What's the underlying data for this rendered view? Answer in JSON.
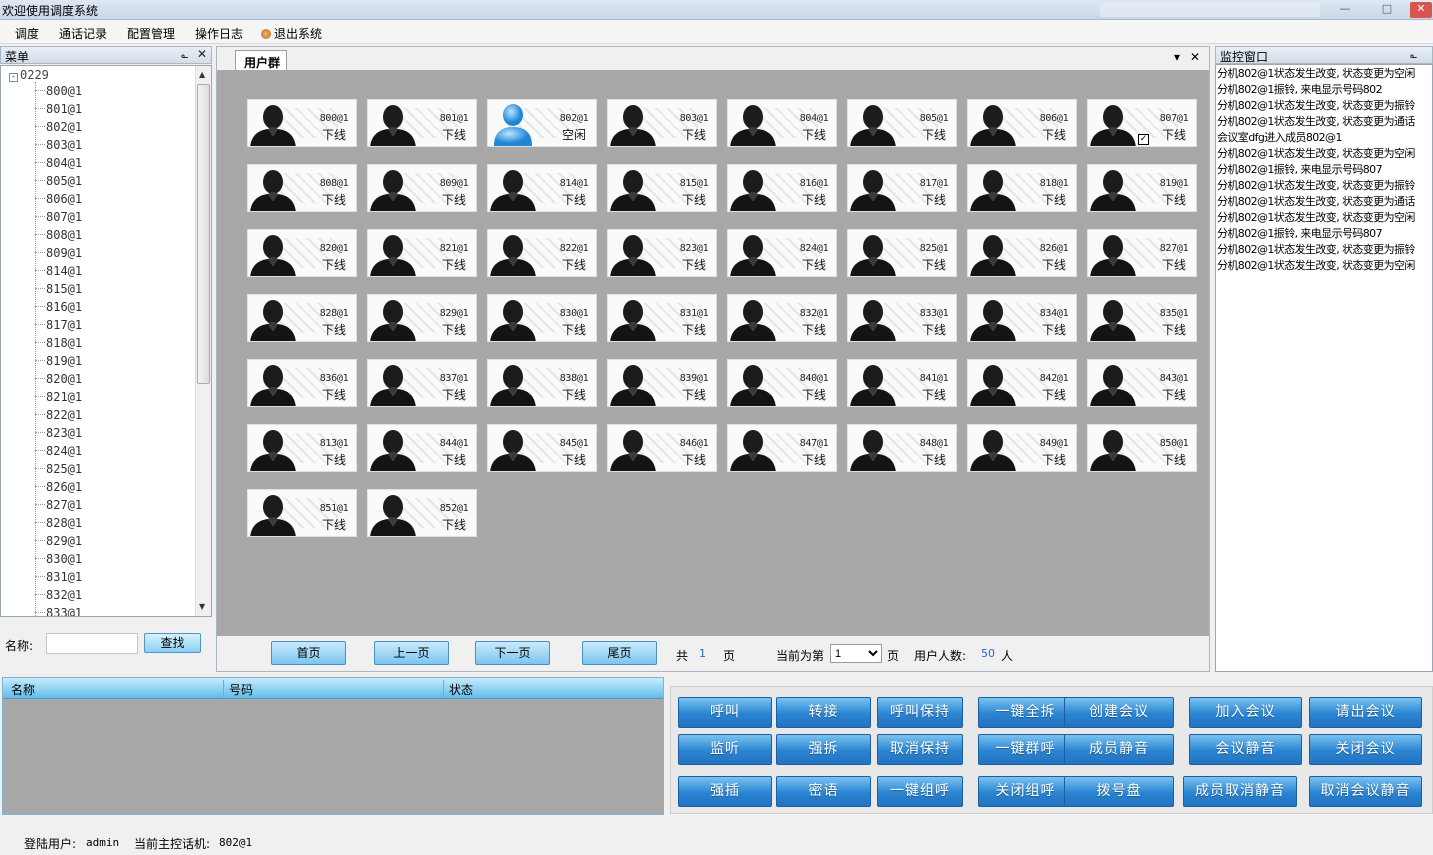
{
  "window": {
    "title": "欢迎使用调度系统"
  },
  "menubar": {
    "items": [
      "调度",
      "通话记录",
      "配置管理",
      "操作日志",
      "退出系统"
    ]
  },
  "menu_panel": {
    "title": "菜单"
  },
  "tree": {
    "root": "0229",
    "nodes": [
      "800@1",
      "801@1",
      "802@1",
      "803@1",
      "804@1",
      "805@1",
      "806@1",
      "807@1",
      "808@1",
      "809@1",
      "814@1",
      "815@1",
      "816@1",
      "817@1",
      "818@1",
      "819@1",
      "820@1",
      "821@1",
      "822@1",
      "823@1",
      "824@1",
      "825@1",
      "826@1",
      "827@1",
      "828@1",
      "829@1",
      "830@1",
      "831@1",
      "832@1",
      "833@1"
    ]
  },
  "search": {
    "label": "名称:",
    "value": "",
    "button": "查找"
  },
  "tabs": {
    "active": "用户群"
  },
  "users": [
    {
      "ext": "800@1",
      "status": "下线"
    },
    {
      "ext": "801@1",
      "status": "下线"
    },
    {
      "ext": "802@1",
      "status": "空闲",
      "online": true
    },
    {
      "ext": "803@1",
      "status": "下线"
    },
    {
      "ext": "804@1",
      "status": "下线"
    },
    {
      "ext": "805@1",
      "status": "下线"
    },
    {
      "ext": "806@1",
      "status": "下线"
    },
    {
      "ext": "807@1",
      "status": "下线",
      "checked": true
    },
    {
      "ext": "808@1",
      "status": "下线"
    },
    {
      "ext": "809@1",
      "status": "下线"
    },
    {
      "ext": "814@1",
      "status": "下线"
    },
    {
      "ext": "815@1",
      "status": "下线"
    },
    {
      "ext": "816@1",
      "status": "下线"
    },
    {
      "ext": "817@1",
      "status": "下线"
    },
    {
      "ext": "818@1",
      "status": "下线"
    },
    {
      "ext": "819@1",
      "status": "下线"
    },
    {
      "ext": "820@1",
      "status": "下线"
    },
    {
      "ext": "821@1",
      "status": "下线"
    },
    {
      "ext": "822@1",
      "status": "下线"
    },
    {
      "ext": "823@1",
      "status": "下线"
    },
    {
      "ext": "824@1",
      "status": "下线"
    },
    {
      "ext": "825@1",
      "status": "下线"
    },
    {
      "ext": "826@1",
      "status": "下线"
    },
    {
      "ext": "827@1",
      "status": "下线"
    },
    {
      "ext": "828@1",
      "status": "下线"
    },
    {
      "ext": "829@1",
      "status": "下线"
    },
    {
      "ext": "830@1",
      "status": "下线"
    },
    {
      "ext": "831@1",
      "status": "下线"
    },
    {
      "ext": "832@1",
      "status": "下线"
    },
    {
      "ext": "833@1",
      "status": "下线"
    },
    {
      "ext": "834@1",
      "status": "下线"
    },
    {
      "ext": "835@1",
      "status": "下线"
    },
    {
      "ext": "836@1",
      "status": "下线"
    },
    {
      "ext": "837@1",
      "status": "下线"
    },
    {
      "ext": "838@1",
      "status": "下线"
    },
    {
      "ext": "839@1",
      "status": "下线"
    },
    {
      "ext": "840@1",
      "status": "下线"
    },
    {
      "ext": "841@1",
      "status": "下线"
    },
    {
      "ext": "842@1",
      "status": "下线"
    },
    {
      "ext": "843@1",
      "status": "下线"
    },
    {
      "ext": "813@1",
      "status": "下线"
    },
    {
      "ext": "844@1",
      "status": "下线"
    },
    {
      "ext": "845@1",
      "status": "下线"
    },
    {
      "ext": "846@1",
      "status": "下线"
    },
    {
      "ext": "847@1",
      "status": "下线"
    },
    {
      "ext": "848@1",
      "status": "下线"
    },
    {
      "ext": "849@1",
      "status": "下线"
    },
    {
      "ext": "850@1",
      "status": "下线"
    },
    {
      "ext": "851@1",
      "status": "下线"
    },
    {
      "ext": "852@1",
      "status": "下线"
    }
  ],
  "pager": {
    "first": "首页",
    "prev": "上一页",
    "next": "下一页",
    "last": "尾页",
    "total_prefix": "共",
    "total_pages": "1",
    "total_suffix": "页",
    "current_prefix": "当前为第",
    "current_page": "1",
    "current_suffix": "页",
    "count_label": "用户人数:",
    "count_value": "50",
    "count_unit": "人"
  },
  "monitor": {
    "title": "监控窗口",
    "lines": [
      "分机802@1状态发生改变, 状态变更为空闲",
      "分机802@1振铃, 来电显示号码802",
      "分机802@1状态发生改变, 状态变更为振铃",
      "分机802@1状态发生改变, 状态变更为通话",
      "会议室dfg进入成员802@1",
      "分机802@1状态发生改变, 状态变更为空闲",
      "分机802@1振铃, 来电显示号码807",
      "分机802@1状态发生改变, 状态变更为振铃",
      "分机802@1状态发生改变, 状态变更为通话",
      "分机802@1状态发生改变, 状态变更为空闲",
      "分机802@1振铃, 来电显示号码807",
      "分机802@1状态发生改变, 状态变更为振铃",
      "分机802@1状态发生改变, 状态变更为空闲"
    ]
  },
  "grid": {
    "columns": [
      "名称",
      "号码",
      "状态"
    ]
  },
  "actions": {
    "row1": [
      "呼叫",
      "转接",
      "呼叫保持",
      "一键全拆",
      "创建会议",
      "加入会议",
      "请出会议"
    ],
    "row2": [
      "监听",
      "强拆",
      "取消保持",
      "一键群呼",
      "成员静音",
      "会议静音",
      "关闭会议"
    ],
    "row3": [
      "强插",
      "密语",
      "一键组呼",
      "关闭组呼",
      "拨号盘",
      "成员取消静音",
      "取消会议静音"
    ]
  },
  "status": {
    "user_label": "登陆用户:",
    "user": "admin",
    "host_label": "当前主控话机:",
    "host": "802@1"
  }
}
